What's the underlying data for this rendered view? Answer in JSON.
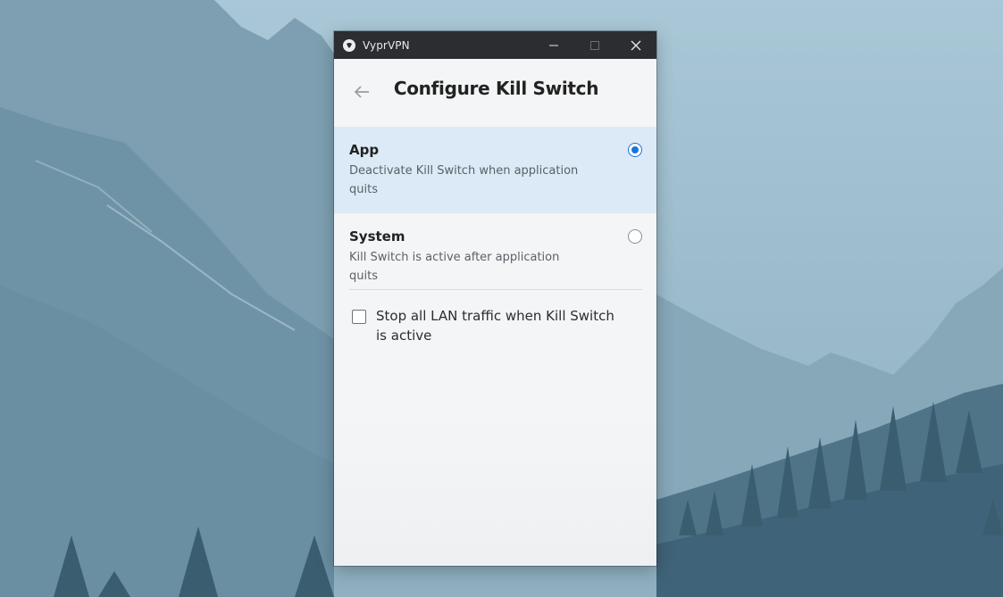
{
  "window": {
    "title": "VyprVPN",
    "controls": [
      "minimize-icon",
      "maximize-icon",
      "close-icon"
    ]
  },
  "header": {
    "back_icon": "arrow-left-icon",
    "title": "Configure Kill Switch"
  },
  "options": [
    {
      "title": "App",
      "description": "Deactivate Kill Switch when application quits",
      "selected": true
    },
    {
      "title": "System",
      "description": "Kill Switch is active after application quits",
      "selected": false
    }
  ],
  "lan_option": {
    "label": "Stop all LAN traffic when Kill Switch is active",
    "checked": false
  },
  "colors": {
    "accent": "#1a73d9",
    "selected_row": "#dbeaf6",
    "titlebar": "#2b2d30"
  }
}
